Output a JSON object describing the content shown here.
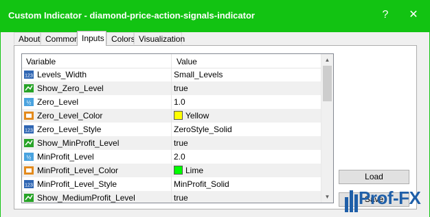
{
  "window": {
    "title": "Custom Indicator - diamond-price-action-signals-indicator",
    "help_glyph": "?",
    "close_glyph": "✕"
  },
  "tabs": [
    {
      "label": "About",
      "active": false
    },
    {
      "label": "Common",
      "active": false
    },
    {
      "label": "Inputs",
      "active": true
    },
    {
      "label": "Colors",
      "active": false
    },
    {
      "label": "Visualization",
      "active": false
    }
  ],
  "grid": {
    "header": {
      "variable": "Variable",
      "value": "Value"
    },
    "rows": [
      {
        "name": "Levels_Width",
        "value": "Small_Levels",
        "icon": "enum-icon"
      },
      {
        "name": "Show_Zero_Level",
        "value": "true",
        "icon": "bool-icon"
      },
      {
        "name": "Zero_Level",
        "value": "1.0",
        "icon": "double-icon"
      },
      {
        "name": "Zero_Level_Color",
        "value": "Yellow",
        "icon": "color-icon",
        "color": "#ffff00"
      },
      {
        "name": "Zero_Level_Style",
        "value": "ZeroStyle_Solid",
        "icon": "enum-icon"
      },
      {
        "name": "Show_MinProfit_Level",
        "value": "true",
        "icon": "bool-icon"
      },
      {
        "name": "MinProfit_Level",
        "value": "2.0",
        "icon": "double-icon"
      },
      {
        "name": "MinProfit_Level_Color",
        "value": "Lime",
        "icon": "color-icon",
        "color": "#00ff00"
      },
      {
        "name": "MinProfit_Level_Style",
        "value": "MinProfit_Solid",
        "icon": "enum-icon"
      },
      {
        "name": "Show_MediumProfit_Level",
        "value": "true",
        "icon": "bool-icon"
      }
    ]
  },
  "buttons": {
    "load": "Load",
    "save": "Save"
  },
  "watermark": {
    "text": "Prof-FX"
  },
  "colors": {
    "titlebar": "#12c312",
    "accent": "#1f5fa8"
  }
}
